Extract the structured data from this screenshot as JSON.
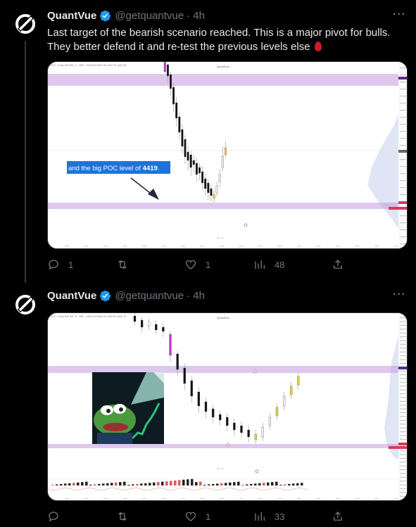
{
  "tweets": [
    {
      "name": "QuantVue",
      "handle": "@getquantvue",
      "time": "· 4h",
      "text": "Last target of the bearish scenario reached. This is a major pivot for bulls. They better defend it and re-test the previous levels else",
      "annotation_prefix": "and the big POC level of ",
      "annotation_value": "4419",
      "annotation_suffix": ".",
      "chart_title": "QuantVue",
      "replies": "1",
      "retweets": "",
      "likes": "1",
      "views": "48"
    },
    {
      "name": "QuantVue",
      "handle": "@getquantvue",
      "time": "· 4h",
      "chart_title": "QuantVue",
      "replies": "",
      "retweets": "",
      "likes": "1",
      "views": "33"
    }
  ],
  "icons": {
    "avatar": "quantvue-logo-icon",
    "verified": "verified-badge-icon",
    "more": "more-options-icon",
    "reply": "reply-icon",
    "retweet": "retweet-icon",
    "like": "heart-icon",
    "views": "views-icon",
    "share": "share-icon"
  },
  "colors": {
    "background": "#000000",
    "text": "#e7e9ea",
    "muted": "#71767b",
    "verified": "#1d9bf0",
    "zone": "#c49be0",
    "annotation_highlight": "#1e73d8"
  }
}
